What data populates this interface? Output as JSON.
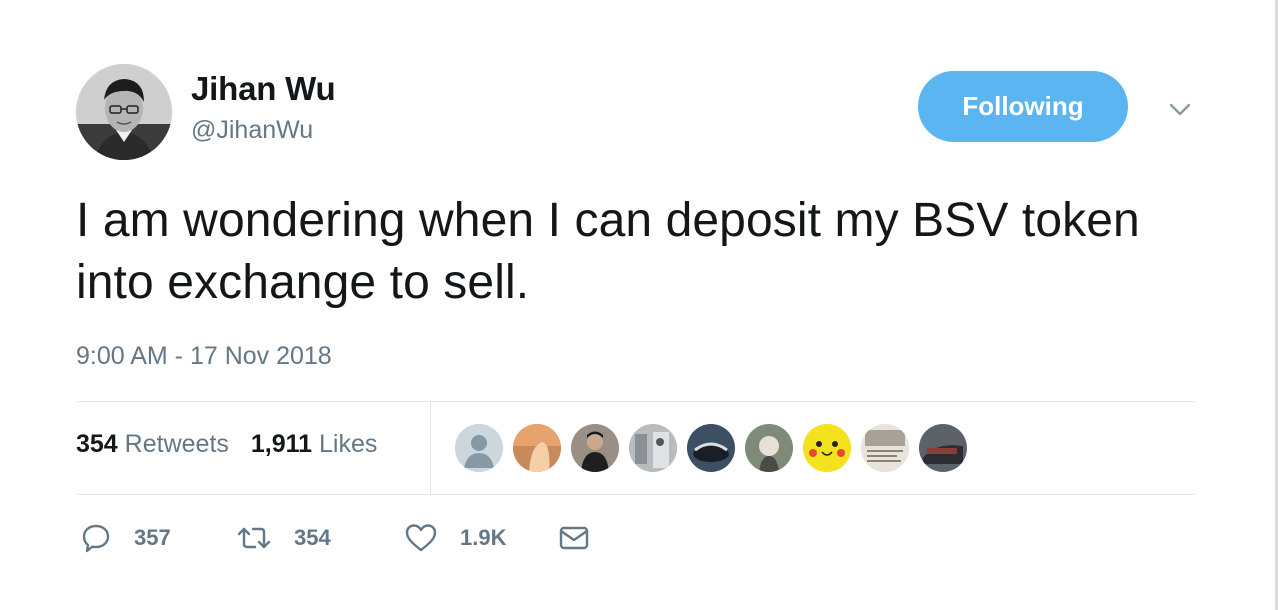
{
  "author": {
    "display_name": "Jihan Wu",
    "screen_name": "@JihanWu"
  },
  "follow_button": {
    "label": "Following",
    "color": "#5bb5f0"
  },
  "tweet": {
    "text": "I am wondering when I can deposit my BSV token into exchange to sell.",
    "timestamp": "9:00 AM - 17 Nov 2018"
  },
  "stats": {
    "retweets_count": "354",
    "retweets_label": "Retweets",
    "likes_count": "1,911",
    "likes_label": "Likes"
  },
  "likers": [
    "default-avatar",
    "avatar",
    "avatar",
    "avatar",
    "avatar",
    "avatar",
    "pikachu-avatar",
    "avatar",
    "avatar"
  ],
  "actions": {
    "reply_count": "357",
    "retweet_count": "354",
    "like_count": "1.9K"
  },
  "icons": {
    "reply": "reply-icon",
    "retweet": "retweet-icon",
    "like": "heart-icon",
    "message": "envelope-icon",
    "caret": "chevron-down-icon"
  }
}
